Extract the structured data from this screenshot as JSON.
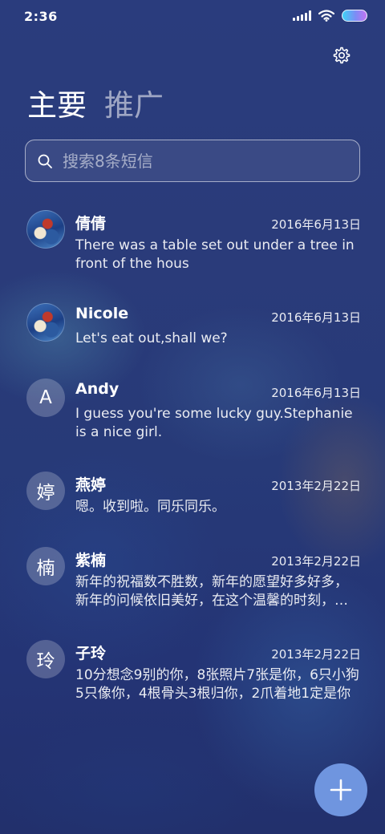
{
  "status_bar": {
    "time": "2:36",
    "icons": [
      "signal-icon",
      "wifi-icon",
      "battery-icon"
    ]
  },
  "header": {
    "settings_icon": "gear-icon",
    "tabs": [
      {
        "label": "主要",
        "active": true
      },
      {
        "label": "推广",
        "active": false
      }
    ]
  },
  "search": {
    "placeholder": "搜索8条短信",
    "value": "",
    "icon": "search-icon"
  },
  "messages": [
    {
      "name": "倩倩",
      "date": "2016年6月13日",
      "preview": "There was a table set out under a tree in front of the hous",
      "avatar_type": "image",
      "avatar_text": ""
    },
    {
      "name": "Nicole",
      "date": "2016年6月13日",
      "preview": "Let's eat out,shall we?",
      "avatar_type": "image",
      "avatar_text": ""
    },
    {
      "name": "Andy",
      "date": "2016年6月13日",
      "preview": "I guess you're some lucky guy.Stephanie is a nice girl.",
      "avatar_type": "letter",
      "avatar_text": "A"
    },
    {
      "name": "燕婷",
      "date": "2013年2月22日",
      "preview": "嗯。收到啦。同乐同乐。",
      "avatar_type": "letter",
      "avatar_text": "婷"
    },
    {
      "name": "紫楠",
      "date": "2013年2月22日",
      "preview": "新年的祝福数不胜数，新年的愿望好多好多，新年的问候依旧美好，在这个温馨的时刻，给你送上最真挚的祝福",
      "avatar_type": "letter",
      "avatar_text": "楠"
    },
    {
      "name": "子玲",
      "date": "2013年2月22日",
      "preview": "10分想念9别的你，8张照片7张是你，6只小狗5只像你，4根骨头3根归你，2爪着地1定是你",
      "avatar_type": "letter",
      "avatar_text": "玲"
    }
  ],
  "fab": {
    "icon": "plus-icon"
  },
  "colors": {
    "fab": "#6f95df",
    "background": "#2a3b7a"
  }
}
